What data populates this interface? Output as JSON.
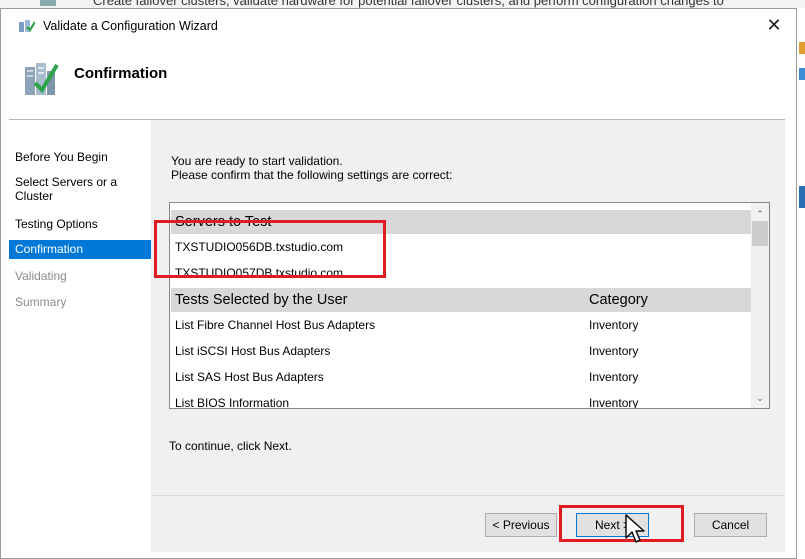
{
  "background_window": {
    "text": "Create failover clusters, validate hardware for potential failover clusters, and perform configuration changes to"
  },
  "dialog": {
    "title": "Validate a Configuration Wizard",
    "close_glyph": "✕",
    "heading": "Confirmation"
  },
  "sidebar": {
    "items": [
      {
        "label": "Before You Begin",
        "state": "normal"
      },
      {
        "label": "Select Servers or a Cluster",
        "state": "normal"
      },
      {
        "label": "Testing Options",
        "state": "normal"
      },
      {
        "label": "Confirmation",
        "state": "active"
      },
      {
        "label": "Validating",
        "state": "disabled"
      },
      {
        "label": "Summary",
        "state": "disabled"
      }
    ]
  },
  "content": {
    "intro_line1": "You are ready to start validation.",
    "intro_line2": "Please confirm that the following settings are correct:",
    "continue_text": "To continue, click Next."
  },
  "settings_list": {
    "servers_header": "Servers to Test",
    "servers": [
      "TXSTUDIO056DB.txstudio.com",
      "TXSTUDIO057DB.txstudio.com"
    ],
    "tests_header": "Tests Selected by the User",
    "category_header": "Category",
    "tests": [
      {
        "name": "List Fibre Channel Host Bus Adapters",
        "category": "Inventory"
      },
      {
        "name": "List iSCSI Host Bus Adapters",
        "category": "Inventory"
      },
      {
        "name": "List SAS Host Bus Adapters",
        "category": "Inventory"
      },
      {
        "name": "List BIOS Information",
        "category": "Inventory"
      }
    ]
  },
  "scrollbar": {
    "up_glyph": "⌃",
    "down_glyph": "⌄"
  },
  "buttons": {
    "previous": "< Previous",
    "next": "Next >",
    "cancel": "Cancel"
  },
  "colors": {
    "selection": "#0078d7",
    "callout": "#e01b22",
    "group_header_bg": "#d8d8d8"
  }
}
